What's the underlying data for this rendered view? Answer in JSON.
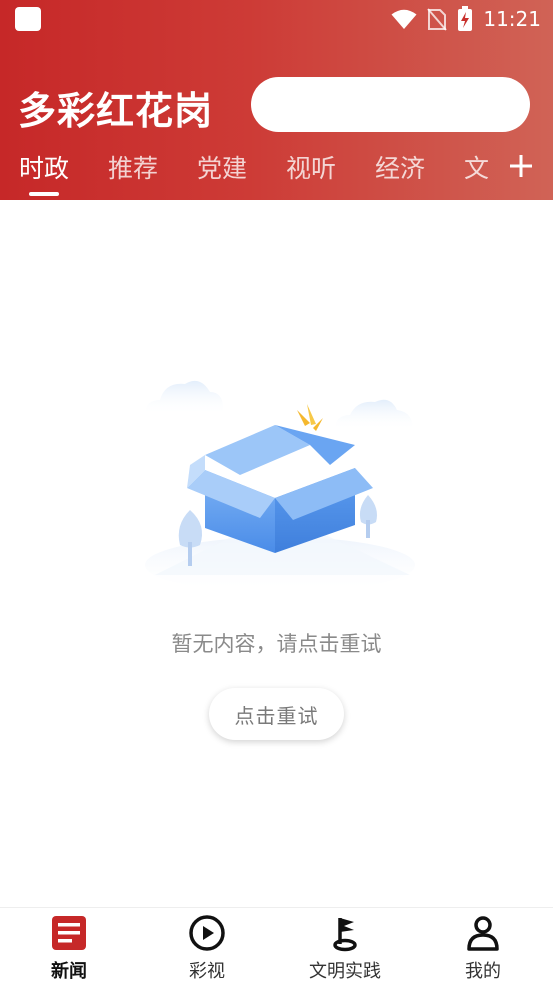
{
  "status_bar": {
    "time": "11:21"
  },
  "header": {
    "app_title": "多彩红花岗",
    "search": {
      "placeholder": ""
    }
  },
  "tabs": [
    {
      "label": "时政",
      "active": true
    },
    {
      "label": "推荐",
      "active": false
    },
    {
      "label": "党建",
      "active": false
    },
    {
      "label": "视听",
      "active": false
    },
    {
      "label": "经济",
      "active": false
    },
    {
      "label": "文",
      "active": false
    }
  ],
  "empty_state": {
    "message": "暂无内容，请点击重试",
    "retry_label": "点击重试"
  },
  "bottom_nav": [
    {
      "label": "新闻",
      "icon": "news-icon",
      "active": true
    },
    {
      "label": "彩视",
      "icon": "play-icon",
      "active": false
    },
    {
      "label": "文明实践",
      "icon": "flag-icon",
      "active": false
    },
    {
      "label": "我的",
      "icon": "user-icon",
      "active": false
    }
  ],
  "colors": {
    "brand_red": "#c62828",
    "header_gradient_end": "#d06356",
    "box_blue": "#5b9ef0"
  }
}
